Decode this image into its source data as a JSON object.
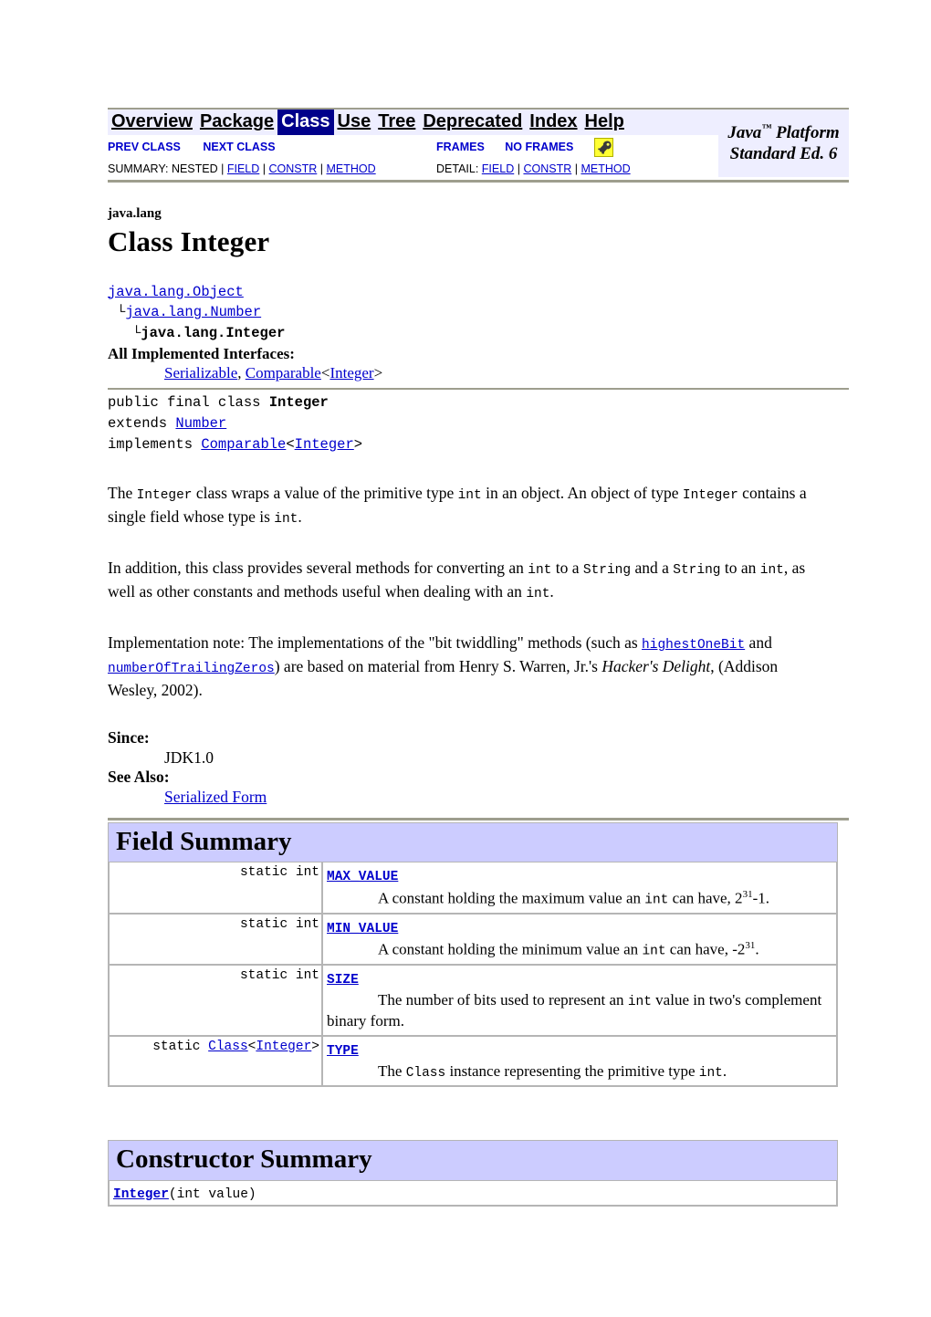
{
  "nav": {
    "items": [
      {
        "label": "Overview",
        "active": false
      },
      {
        "label": "Package",
        "active": false
      },
      {
        "label": "Class",
        "active": true
      },
      {
        "label": "Use",
        "active": false
      },
      {
        "label": "Tree",
        "active": false
      },
      {
        "label": "Deprecated",
        "active": false
      },
      {
        "label": "Index",
        "active": false
      },
      {
        "label": "Help",
        "active": false
      }
    ],
    "brand_line1": "Java",
    "brand_tm": "™",
    "brand_line1_rest": " Platform",
    "brand_line2": "Standard Ed. 6",
    "prev_class": "PREV CLASS",
    "next_class": "NEXT CLASS",
    "frames": "FRAMES",
    "no_frames": "NO FRAMES",
    "allclasses_icon": "all-classes-icon",
    "summary_label": "SUMMARY:",
    "summary_nested": "NESTED",
    "summary_field": "FIELD",
    "summary_constr": "CONSTR",
    "summary_method": "METHOD",
    "detail_label": "DETAIL:",
    "detail_field": "FIELD",
    "detail_constr": "CONSTR",
    "detail_method": "METHOD",
    "separator": "|"
  },
  "header": {
    "package": "java.lang",
    "title": "Class Integer"
  },
  "hierarchy": {
    "level1": "java.lang.Object",
    "level2": "java.lang.Number",
    "level3": "java.lang.Integer",
    "corner": "└"
  },
  "implemented": {
    "title": "All Implemented Interfaces:",
    "serializable": "Serializable",
    "comma": ", ",
    "comparable": "Comparable",
    "generic_open": "<",
    "comparable_arg": "Integer",
    "generic_close": ">"
  },
  "declaration": {
    "line1_prefix": "public final class ",
    "line1_name": "Integer",
    "line2_prefix": "extends ",
    "line2_link": "Number",
    "line3_prefix": "implements ",
    "line3_link": "Comparable",
    "line3_open": "<",
    "line3_arg": "Integer",
    "line3_close": ">"
  },
  "description": {
    "p1": {
      "t1": "The ",
      "c1": "Integer",
      "t2": " class wraps a value of the primitive type ",
      "c2": "int",
      "t3": " in an object. An object of type ",
      "c3": "Integer",
      "t4": " contains a single field whose type is ",
      "c4": "int",
      "t5": "."
    },
    "p2": {
      "t1": "In addition, this class provides several methods for converting an ",
      "c1": "int",
      "t2": " to a ",
      "c2": "String",
      "t3": " and a ",
      "c3": "String",
      "t4": " to an ",
      "c4": "int",
      "t5": ", as well as other constants and methods useful when dealing with an ",
      "c5": "int",
      "t6": "."
    },
    "p3": {
      "t1": "Implementation note: The implementations of the \"bit twiddling\" methods (such as ",
      "link1": "highestOneBit",
      "t2": " and ",
      "link2": "numberOfTrailingZeros",
      "t3": ") are based on material from Henry S. Warren, Jr.'s ",
      "italic": "Hacker's Delight",
      "t4": ", (Addison Wesley, 2002)."
    }
  },
  "since": {
    "label": "Since:",
    "value": "JDK1.0"
  },
  "see_also": {
    "label": "See Also:",
    "link": "Serialized Form"
  },
  "field_summary": {
    "heading": "Field Summary",
    "rows": [
      {
        "type_prefix": "static int",
        "type_link": "",
        "type_generic": "",
        "name": "MAX_VALUE",
        "desc": {
          "t1": "A constant holding the maximum value an ",
          "c1": "int",
          "t2": " can have, 2",
          "sup": "31",
          "t3": "-1."
        }
      },
      {
        "type_prefix": "static int",
        "type_link": "",
        "type_generic": "",
        "name": "MIN_VALUE",
        "desc": {
          "t1": "A constant holding the minimum value an ",
          "c1": "int",
          "t2": " can have, -2",
          "sup": "31",
          "t3": "."
        }
      },
      {
        "type_prefix": "static int",
        "type_link": "",
        "type_generic": "",
        "name": "SIZE",
        "desc": {
          "t1": "The number of bits used to represent an ",
          "c1": "int",
          "t2": " value in two's complement binary form.",
          "sup": "",
          "t3": ""
        }
      },
      {
        "type_prefix": "static ",
        "type_link": "Class",
        "type_generic": "<Integer>",
        "name": "TYPE",
        "desc": {
          "t1": "The ",
          "c1": "Class",
          "t2": " instance representing the primitive type ",
          "sup": "",
          "t3": ""
        }
      }
    ]
  },
  "field_type_row4": {
    "static_kw": "static ",
    "class_link": "Class",
    "lt": "<",
    "arg": "Integer",
    "gt": ">"
  },
  "field_desc_row4_tail": {
    "c2": "int",
    "period": "."
  },
  "constructor_summary": {
    "heading": "Constructor Summary",
    "rows": [
      {
        "name": "Integer",
        "signature": "(int value)"
      }
    ]
  }
}
